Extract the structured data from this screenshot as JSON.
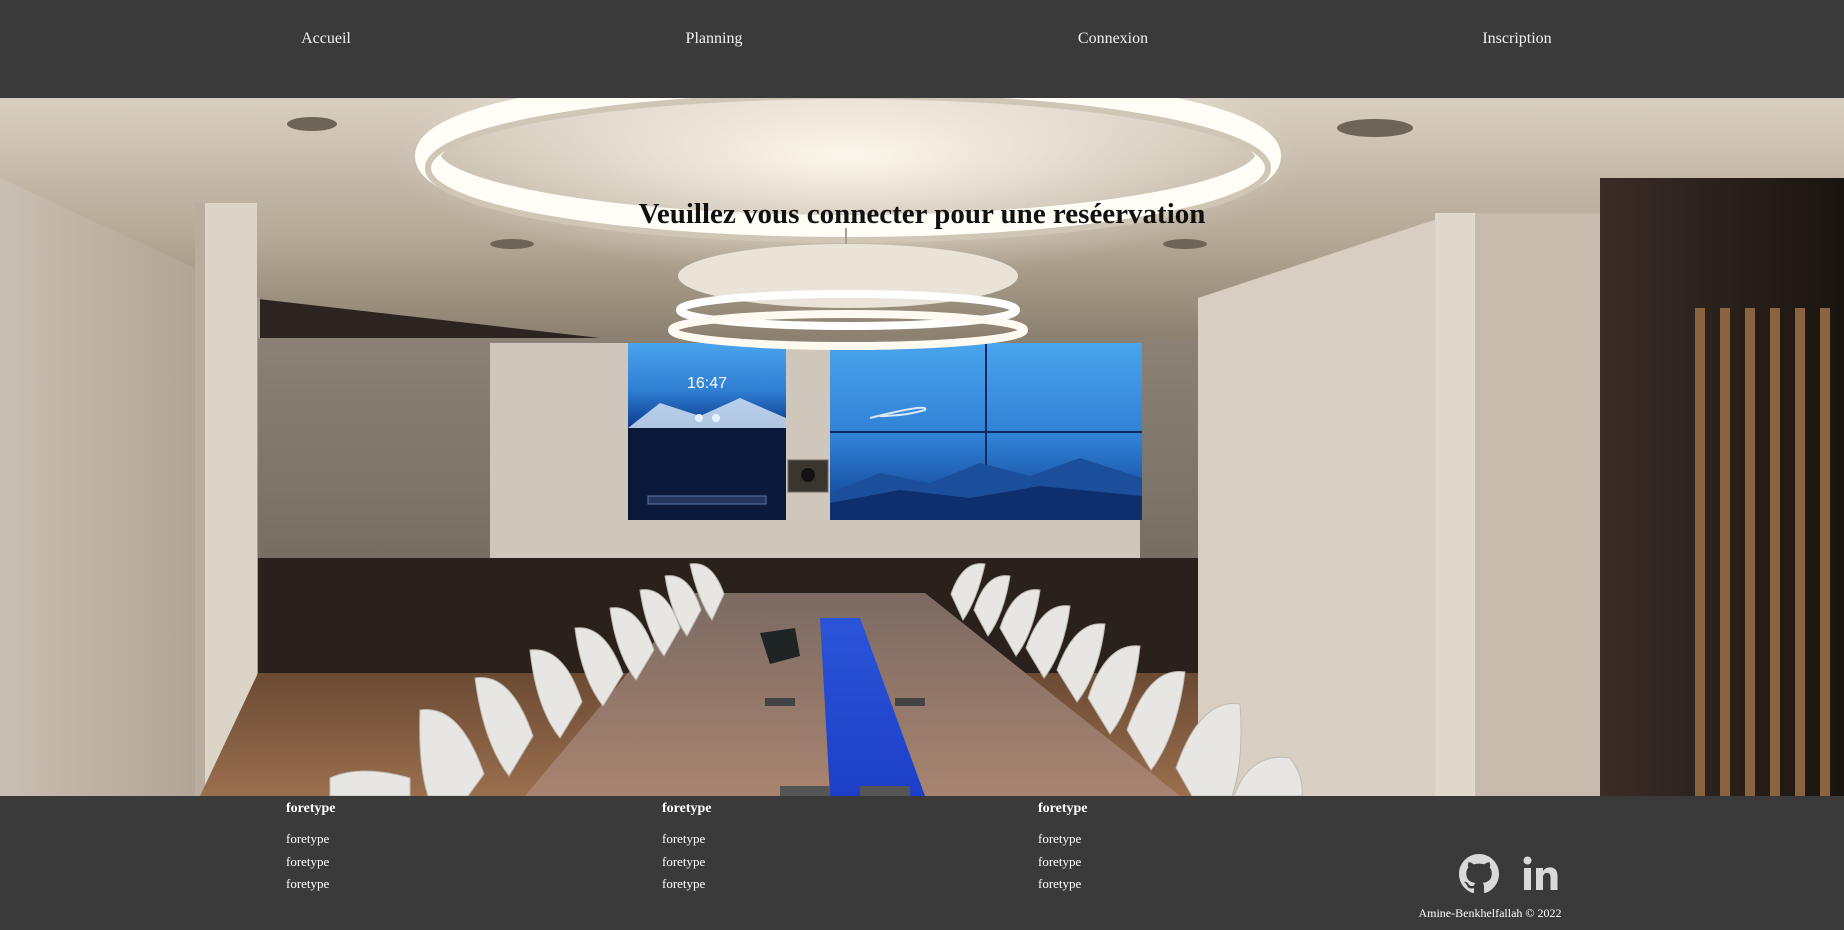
{
  "nav": {
    "items": [
      {
        "label": "Accueil"
      },
      {
        "label": "Planning"
      },
      {
        "label": "Connexion"
      },
      {
        "label": "Inscription"
      }
    ]
  },
  "hero": {
    "title": "Veuillez vous connecter pour une reséervation",
    "screen_clock": "16:47"
  },
  "footer": {
    "columns": [
      {
        "title": "foretype",
        "items": [
          "foretype",
          "foretype",
          "foretype"
        ]
      },
      {
        "title": "foretype",
        "items": [
          "foretype",
          "foretype",
          "foretype"
        ]
      },
      {
        "title": "foretype",
        "items": [
          "foretype",
          "foretype",
          "foretype"
        ]
      }
    ],
    "social": [
      {
        "icon": "github-icon"
      },
      {
        "icon": "linkedin-icon"
      }
    ],
    "copyright": "Amine-Benkhelfallah © 2022"
  },
  "colors": {
    "nav_bg": "#3a3a3a",
    "footer_bg": "#3a3a3a",
    "nav_text": "#f2f2f2",
    "footer_text": "#ffffff",
    "accent_blue": "#1f4fd6"
  }
}
